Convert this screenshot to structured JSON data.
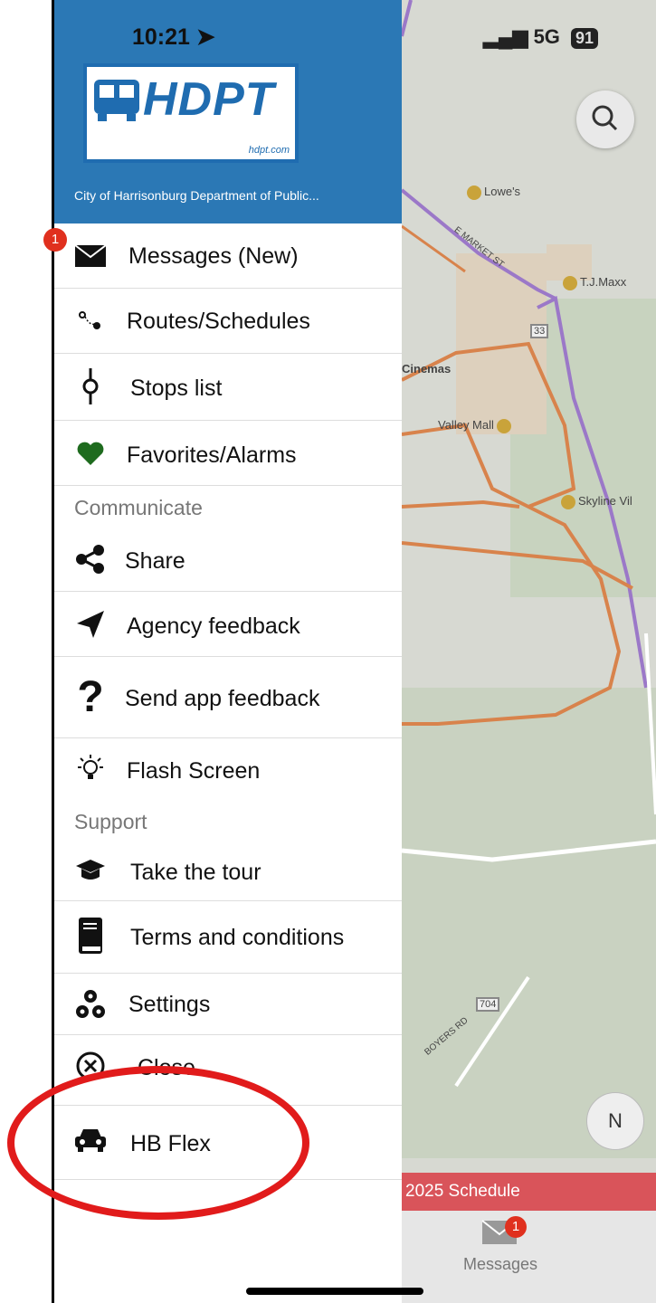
{
  "status_bar": {
    "time": "10:21",
    "network": "5G",
    "battery": "91"
  },
  "header": {
    "logo_text": "HDPT",
    "logo_url": "hdpt.com",
    "agency_name": "City of Harrisonburg Department of Public..."
  },
  "menu": {
    "items": [
      {
        "label": "Messages (New)",
        "icon": "envelope-icon",
        "badge": "1"
      },
      {
        "label": "Routes/Schedules",
        "icon": "route-icon"
      },
      {
        "label": "Stops list",
        "icon": "stop-icon"
      },
      {
        "label": "Favorites/Alarms",
        "icon": "heart-icon"
      }
    ],
    "communicate_header": "Communicate",
    "communicate_items": [
      {
        "label": "Share",
        "icon": "share-icon"
      },
      {
        "label": "Agency feedback",
        "icon": "paper-plane-icon"
      },
      {
        "label": "Send app feedback",
        "icon": "question-icon"
      },
      {
        "label": "Flash Screen",
        "icon": "lightbulb-icon"
      }
    ],
    "support_header": "Support",
    "support_items": [
      {
        "label": "Take the tour",
        "icon": "graduation-cap-icon"
      },
      {
        "label": "Terms and conditions",
        "icon": "book-icon"
      },
      {
        "label": "Settings",
        "icon": "cogs-icon"
      },
      {
        "label": "Close",
        "icon": "close-circle-icon"
      },
      {
        "label": "HB Flex",
        "icon": "car-icon"
      }
    ]
  },
  "map": {
    "pois": [
      "Lowe's",
      "T.J.Maxx",
      "Cinemas",
      "Valley Mall",
      "Skyline Vil"
    ],
    "road_labels": [
      "E MARKET ST",
      "BOYERS RD"
    ],
    "route_shields": [
      "33",
      "704"
    ],
    "compass_label": "N",
    "schedule_banner": "2025 Schedule"
  },
  "tab_bar": {
    "messages_label": "Messages",
    "messages_badge": "1"
  },
  "colors": {
    "header_blue": "#2b78b5",
    "highlight_red": "#e11b1b",
    "badge_red": "#e0301e",
    "heart_green": "#1e6b1e"
  }
}
